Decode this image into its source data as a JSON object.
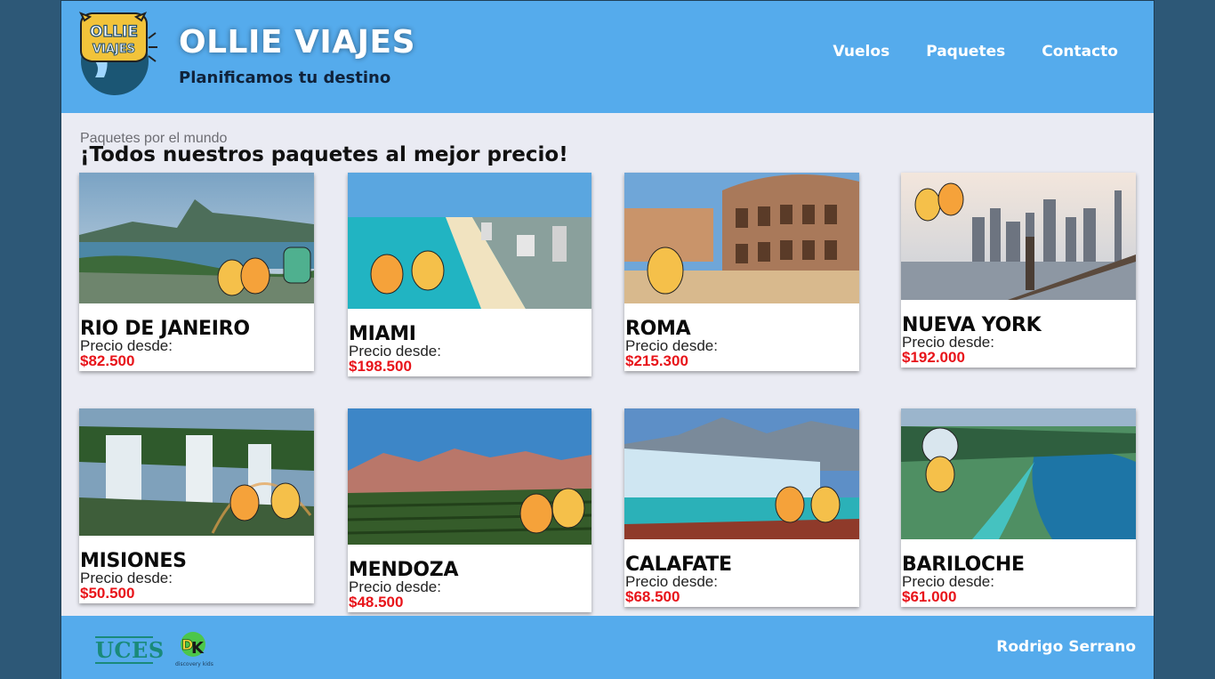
{
  "brand": {
    "logo_text_line1": "OLLIE",
    "logo_text_line2": "VIAJES",
    "title": "OLLIE VIAJES",
    "subtitle": "Planificamos tu destino"
  },
  "nav": {
    "items": [
      {
        "label": "Vuelos"
      },
      {
        "label": "Paquetes"
      },
      {
        "label": "Contacto"
      }
    ]
  },
  "section": {
    "kicker": "Paquetes por el mundo",
    "title": "¡Todos nuestros paquetes al mejor precio!"
  },
  "packages": [
    {
      "name": "RIO DE JANEIRO",
      "from_label": "Precio desde:",
      "price": "$82.500",
      "scene": "rio-photo"
    },
    {
      "name": "MIAMI",
      "from_label": "Precio desde:",
      "price": "$198.500",
      "scene": "miami-photo"
    },
    {
      "name": "ROMA",
      "from_label": "Precio desde:",
      "price": "$215.300",
      "scene": "roma-photo"
    },
    {
      "name": "NUEVA YORK",
      "from_label": "Precio desde:",
      "price": "$192.000",
      "scene": "nueva-york-photo"
    },
    {
      "name": "MISIONES",
      "from_label": "Precio desde:",
      "price": "$50.500",
      "scene": "misiones-photo"
    },
    {
      "name": "MENDOZA",
      "from_label": "Precio desde:",
      "price": "$48.500",
      "scene": "mendoza-photo"
    },
    {
      "name": "CALAFATE",
      "from_label": "Precio desde:",
      "price": "$68.500",
      "scene": "calafate-photo"
    },
    {
      "name": "BARILOCHE",
      "from_label": "Precio desde:",
      "price": "$61.000",
      "scene": "bariloche-photo"
    }
  ],
  "footer": {
    "sponsor1": "UCES",
    "sponsor2_caption": "discovery kids",
    "author": "Rodrigo Serrano"
  },
  "colors": {
    "header_bg": "#55abec",
    "page_bg": "#eaebf3",
    "outer_bg": "#2d5877",
    "price": "#e8141a"
  }
}
